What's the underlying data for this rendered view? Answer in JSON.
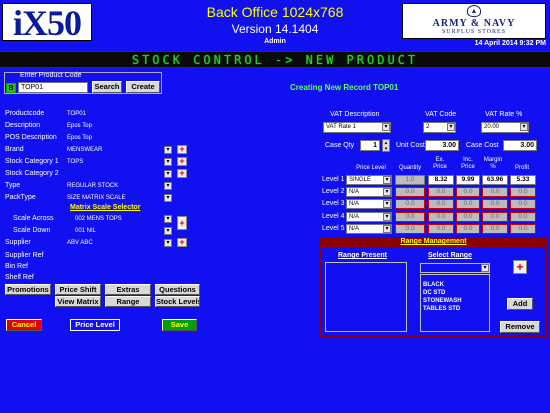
{
  "header": {
    "logo": "iX50",
    "title": "Back Office 1024x768",
    "version": "Version 14.1404",
    "user": "Admin",
    "brand_line1": "ARMY & NAVY",
    "brand_line2": "SURPLUS STORES",
    "date": "14 April 2014 9:32 PM",
    "banner": "STOCK CONTROL -> NEW PRODUCT"
  },
  "product_code": {
    "label": "Enter Product Code",
    "badge": "B",
    "value": "TOP01",
    "search_label": "Search",
    "create_label": "Create",
    "status": "Creating New Record TOP01"
  },
  "form": {
    "productcode": {
      "label": "Productcode",
      "value": "TOP01"
    },
    "description": {
      "label": "Description",
      "value": "Epos Top"
    },
    "pos_description": {
      "label": "POS Description",
      "value": "Epos Top"
    },
    "brand": {
      "label": "Brand",
      "value": "MENSWEAR"
    },
    "stock_category_1": {
      "label": "Stock Category 1",
      "value": "TOPS"
    },
    "stock_category_2": {
      "label": "Stock Category 2",
      "value": ""
    },
    "type": {
      "label": "Type",
      "value": "REGULAR STOCK"
    },
    "packtype": {
      "label": "PackType",
      "value": "SIZE MATRIX SCALE"
    },
    "matrix_title": "Matrix Scale Selector",
    "scale_across": {
      "label": "Scale Across",
      "value": "002 MENS TOPS"
    },
    "scale_down": {
      "label": "Scale Down",
      "value": "001 NIL"
    },
    "supplier": {
      "label": "Supplier",
      "value": "ABV  ABC"
    },
    "supplier_ref": {
      "label": "Supplier Ref"
    },
    "bin_ref": {
      "label": "Bin Ref"
    },
    "shelf_ref": {
      "label": "Shelf Ref"
    }
  },
  "buttons": {
    "promotions": "Promotions",
    "price_shift": "Price Shift",
    "extras": "Extras",
    "questions": "Questions",
    "view_matrix": "View Matrix",
    "range": "Range",
    "stock_levels": "Stock Levels",
    "cancel": "Cancel",
    "price_level": "Price Level",
    "save": "Save",
    "add": "Add",
    "remove": "Remove"
  },
  "vat": {
    "desc_label": "VAT Description",
    "desc_value": "VAT Rate 1",
    "code_label": "VAT Code",
    "code_value": "2",
    "rate_label": "VAT Rate %",
    "rate_value": "20.00",
    "case_qty_label": "Case Qty",
    "case_qty_value": "1",
    "unit_cost_label": "Unit Cost",
    "unit_cost_value": "3.00",
    "case_cost_label": "Case Cost",
    "case_cost_value": "3.00"
  },
  "price_table": {
    "headers": {
      "price_level": "Price Level",
      "quantity": "Quantity",
      "ex_price": "Ex.\nPrice",
      "inc_price": "Inc.\nPrice",
      "margin": "Margin\n%",
      "profit": "Profit"
    },
    "rows": [
      {
        "label": "Level 1",
        "level": "SINGLE",
        "qty": "1.0",
        "ex": "8.32",
        "inc": "9.99",
        "margin": "63.96",
        "profit": "5.33"
      },
      {
        "label": "Level 2",
        "level": "N/A",
        "qty": "0.0",
        "ex": "0.0",
        "inc": "0.0",
        "margin": "0.0",
        "profit": "0.0"
      },
      {
        "label": "Level 3",
        "level": "N/A",
        "qty": "0.0",
        "ex": "0.0",
        "inc": "0.0",
        "margin": "0.0",
        "profit": "0.0"
      },
      {
        "label": "Level 4",
        "level": "N/A",
        "qty": "0.0",
        "ex": "0.0",
        "inc": "0.0",
        "margin": "0.0",
        "profit": "0.0"
      },
      {
        "label": "Level 5",
        "level": "N/A",
        "qty": "0.0",
        "ex": "0.0",
        "inc": "0.0",
        "margin": "0.0",
        "profit": "0.0"
      }
    ]
  },
  "range_management": {
    "title": "Range Management",
    "present_label": "Range Present",
    "select_label": "Select Range",
    "options": [
      "BLACK",
      "DC STD",
      "STONEWASH",
      "TABLES STD"
    ]
  },
  "colors": {
    "background": "#1010f0",
    "title": "#ffff00",
    "banner_text": "#1fd61f",
    "status": "#60ff60",
    "range_header": "#8a0000",
    "cancel": "#e00000",
    "save": "#00a000"
  }
}
